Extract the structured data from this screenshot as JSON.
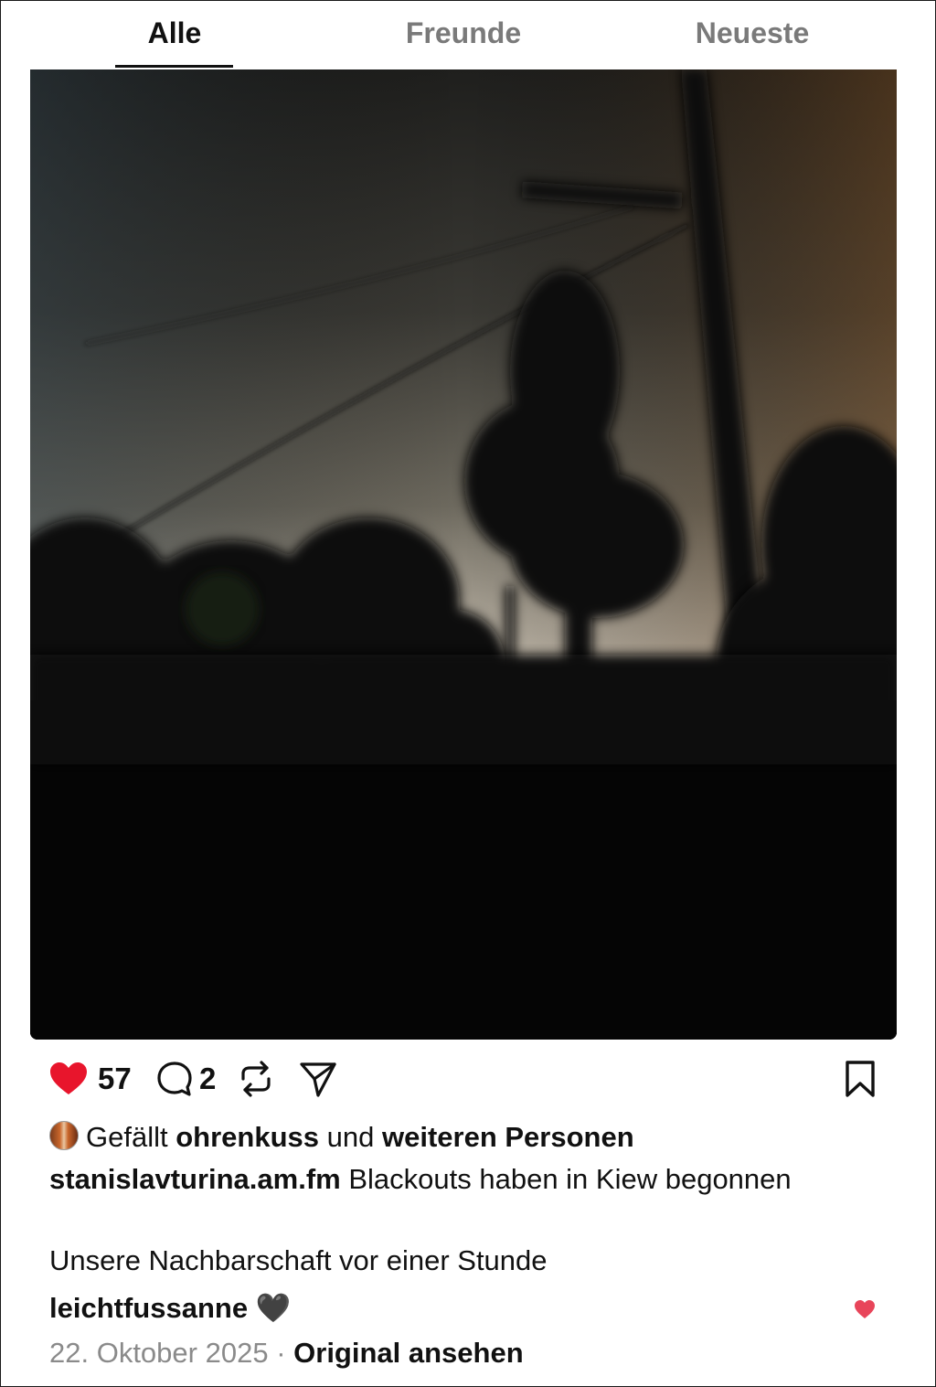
{
  "tabs": [
    {
      "label": "Alle",
      "active": true
    },
    {
      "label": "Freunde",
      "active": false
    },
    {
      "label": "Neueste",
      "active": false
    }
  ],
  "post": {
    "image_description": "",
    "actions": {
      "likes": "57",
      "comments": "2",
      "like_icon": "heart-filled-icon",
      "comment_icon": "comment-bubble-icon",
      "repost_icon": "repost-icon",
      "share_icon": "paper-plane-icon",
      "bookmark_icon": "bookmark-icon"
    },
    "liked_by": {
      "prefix": "Gefällt",
      "user": "ohrenkuss",
      "middle": "und",
      "others": "weiteren Personen"
    },
    "caption": {
      "author": "stanislavturina.am.fm",
      "text": "Blackouts haben in Kiew begonnen",
      "second_line": "Unsere Nachbarschaft vor einer Stunde"
    },
    "top_comment": {
      "user": "leichtfussanne",
      "text": "🖤"
    },
    "date": "22. Oktober 2025",
    "separator": "·",
    "view_original": "Original ansehen"
  },
  "colors": {
    "accent_red": "#e8152c",
    "muted_text": "#8a8a8a",
    "small_heart": "#e8455a"
  }
}
